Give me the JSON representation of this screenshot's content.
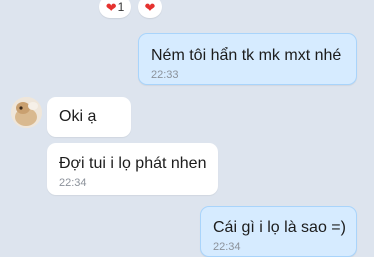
{
  "reactions": {
    "heart_icon": "❤",
    "count": "1"
  },
  "messages": [
    {
      "id": "m1",
      "text": "Ném tôi hẩn tk mk mxt nhé",
      "time": "22:33",
      "direction": "outgoing"
    },
    {
      "id": "m2",
      "text": "Oki ạ",
      "time": "",
      "direction": "incoming"
    },
    {
      "id": "m3",
      "text": "Đợi tui i lọ phát nhen",
      "time": "22:34",
      "direction": "incoming"
    },
    {
      "id": "m4",
      "text": "Cái gì i lọ là sao =)",
      "time": "22:34",
      "direction": "outgoing"
    }
  ],
  "colors": {
    "background": "#dde4ee",
    "incoming_bubble": "#ffffff",
    "outgoing_bubble": "#d6ebff",
    "heart": "#e5322f"
  }
}
